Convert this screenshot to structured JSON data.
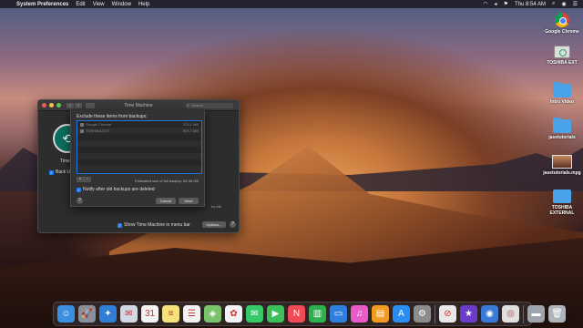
{
  "menubar": {
    "apple": "",
    "app_name": "System Preferences",
    "items": [
      "Edit",
      "View",
      "Window",
      "Help"
    ],
    "time": "Thu 8:54 AM",
    "status_icons": [
      "wifi-icon",
      "volume-icon",
      "flag-icon",
      "spotlight-icon",
      "siri-icon",
      "list-icon"
    ]
  },
  "desktop_icons": [
    {
      "label": "Google Chrome",
      "icon": "chrome-icon"
    },
    {
      "label": "TOSHIBA EXT",
      "icon": "drive-icon"
    },
    {
      "label": "Intro Video",
      "icon": "folder-icon"
    },
    {
      "label": "jasetutorials",
      "icon": "folder-icon"
    },
    {
      "label": "jasetutorials.mpg",
      "icon": "video-thumbnail-icon"
    },
    {
      "label": "TOSHIBA EXTERNAL",
      "icon": "folder-icon"
    }
  ],
  "tm_window": {
    "title": "Time Machine",
    "search_placeholder": "Search",
    "label": "Time M",
    "backup_label": "Back Up",
    "side_text": "ey full.",
    "menubar_option": "Show Time Machine in menu bar",
    "options_button": "Options...",
    "help_button": "?"
  },
  "sheet": {
    "title": "Exclude these items from backups:",
    "rows": [
      {
        "name": "Google Chrome",
        "size": "378.1 MB"
      },
      {
        "name": "TOSHIBA EXT",
        "size": "809.7 MB"
      },
      {
        "name": "",
        "size": ""
      },
      {
        "name": "",
        "size": ""
      },
      {
        "name": "",
        "size": ""
      },
      {
        "name": "",
        "size": ""
      },
      {
        "name": "",
        "size": ""
      },
      {
        "name": "",
        "size": ""
      }
    ],
    "plus": "+",
    "minus": "−",
    "estimate": "Estimated size of full backup: 65.08 GB",
    "notify_label": "Notify after old backups are deleted",
    "help": "?",
    "cancel": "Cancel",
    "save": "Save"
  },
  "dock": {
    "items": [
      {
        "name": "finder",
        "glyph": "☺",
        "color": "#3b8fe0"
      },
      {
        "name": "launchpad",
        "glyph": "🚀",
        "color": "#8a8f99"
      },
      {
        "name": "safari",
        "glyph": "✦",
        "color": "#2f7fd6"
      },
      {
        "name": "mail",
        "glyph": "✉",
        "color": "#cfd8e4"
      },
      {
        "name": "calendar",
        "glyph": "31",
        "color": "#f4f4f4"
      },
      {
        "name": "notes",
        "glyph": "≡",
        "color": "#f5e27a"
      },
      {
        "name": "reminders",
        "glyph": "☰",
        "color": "#f2f2f2"
      },
      {
        "name": "maps",
        "glyph": "◈",
        "color": "#79c36b"
      },
      {
        "name": "photos",
        "glyph": "✿",
        "color": "#f2f2f2"
      },
      {
        "name": "messages",
        "glyph": "✉",
        "color": "#36c96a"
      },
      {
        "name": "facetime",
        "glyph": "▶",
        "color": "#3cbf59"
      },
      {
        "name": "news",
        "glyph": "N",
        "color": "#f04a55"
      },
      {
        "name": "numbers",
        "glyph": "▥",
        "color": "#2bb24c"
      },
      {
        "name": "keynote",
        "glyph": "▭",
        "color": "#2f7fe0"
      },
      {
        "name": "itunes",
        "glyph": "♫",
        "color": "#e85cc7"
      },
      {
        "name": "ibooks",
        "glyph": "▤",
        "color": "#f29b22"
      },
      {
        "name": "app-store",
        "glyph": "A",
        "color": "#2a8df0"
      },
      {
        "name": "system-preferences",
        "glyph": "⚙",
        "color": "#8c8c8c"
      },
      {
        "name": "no-entry",
        "glyph": "⊘",
        "color": "#e8e8e8"
      },
      {
        "name": "imovie",
        "glyph": "★",
        "color": "#6a3cc9"
      },
      {
        "name": "screen-recorder",
        "glyph": "◉",
        "color": "#3a7ad6"
      },
      {
        "name": "chrome",
        "glyph": "◎",
        "color": "#e0e0e0"
      },
      {
        "name": "video-player",
        "glyph": "▬",
        "color": "#9ea4ab"
      },
      {
        "name": "trash",
        "glyph": "🗑",
        "color": "#aeb4ba"
      }
    ]
  }
}
